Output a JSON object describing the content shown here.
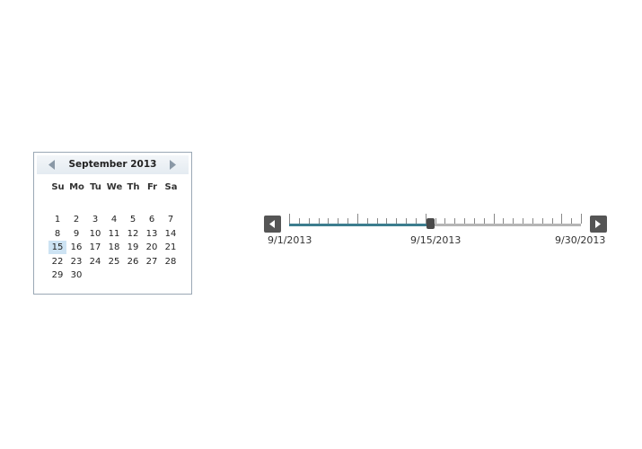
{
  "calendar": {
    "title": "September 2013",
    "prev_icon": "triangle-left-icon",
    "next_icon": "triangle-right-icon",
    "weekdays": [
      "Su",
      "Mo",
      "Tu",
      "We",
      "Th",
      "Fr",
      "Sa"
    ],
    "first_weekday_index": 0,
    "days": [
      "1",
      "2",
      "3",
      "4",
      "5",
      "6",
      "7",
      "8",
      "9",
      "10",
      "11",
      "12",
      "13",
      "14",
      "15",
      "16",
      "17",
      "18",
      "19",
      "20",
      "21",
      "22",
      "23",
      "24",
      "25",
      "26",
      "27",
      "28",
      "29",
      "30"
    ],
    "selected_day": "15",
    "selection_color": "#cde3f3"
  },
  "timeline": {
    "prev_icon": "triangle-left-icon",
    "next_icon": "triangle-right-icon",
    "start_label": "9/1/2013",
    "mid_label": "9/15/2013",
    "end_label": "9/30/2013",
    "total_days": 30,
    "value_day": 15,
    "fill_color": "#3c7d8e"
  }
}
